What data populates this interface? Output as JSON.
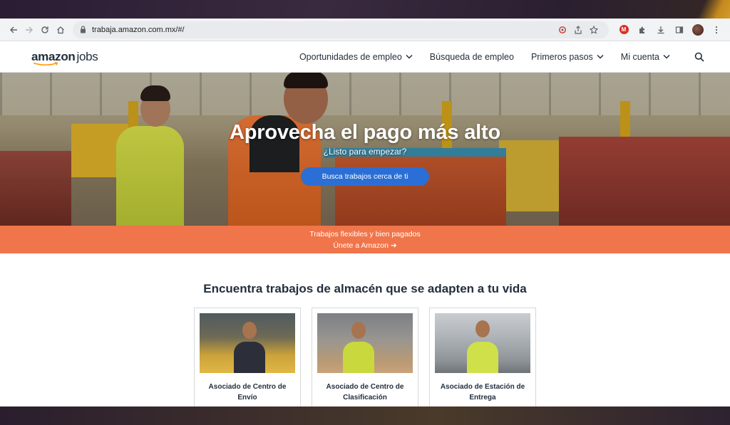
{
  "browser": {
    "url": "trabaja.amazon.com.mx/#/"
  },
  "site": {
    "logo_main": "amazon",
    "logo_sub": "jobs",
    "nav": [
      {
        "label": "Oportunidades de empleo",
        "has_dropdown": true
      },
      {
        "label": "Búsqueda de empleo",
        "has_dropdown": false
      },
      {
        "label": "Primeros pasos",
        "has_dropdown": true
      },
      {
        "label": "Mi cuenta",
        "has_dropdown": true
      }
    ]
  },
  "hero": {
    "title": "Aprovecha el pago más alto",
    "subtitle": "¿Listo para empezar?",
    "cta_label": "Busca trabajos cerca de ti"
  },
  "promo": {
    "line1": "Trabajos flexibles y bien pagados",
    "link_label": "Únete a Amazon ➜"
  },
  "section": {
    "title": "Encuentra trabajos de almacén que se adapten a tu vida"
  },
  "cards": [
    {
      "label": "Asociado de Centro de Envío"
    },
    {
      "label": "Asociado de Centro de Clasificación"
    },
    {
      "label": "Asociado de Estación de Entrega"
    }
  ],
  "colors": {
    "promo": "#f0754a",
    "cta": "#2b6fd6",
    "text_dark": "#232f3e",
    "logo_smile": "#ff9900"
  },
  "icons": {
    "back": "arrow-left-icon",
    "forward": "arrow-right-icon",
    "reload": "reload-icon",
    "home": "home-icon",
    "lock": "lock-icon",
    "search": "search-icon"
  }
}
